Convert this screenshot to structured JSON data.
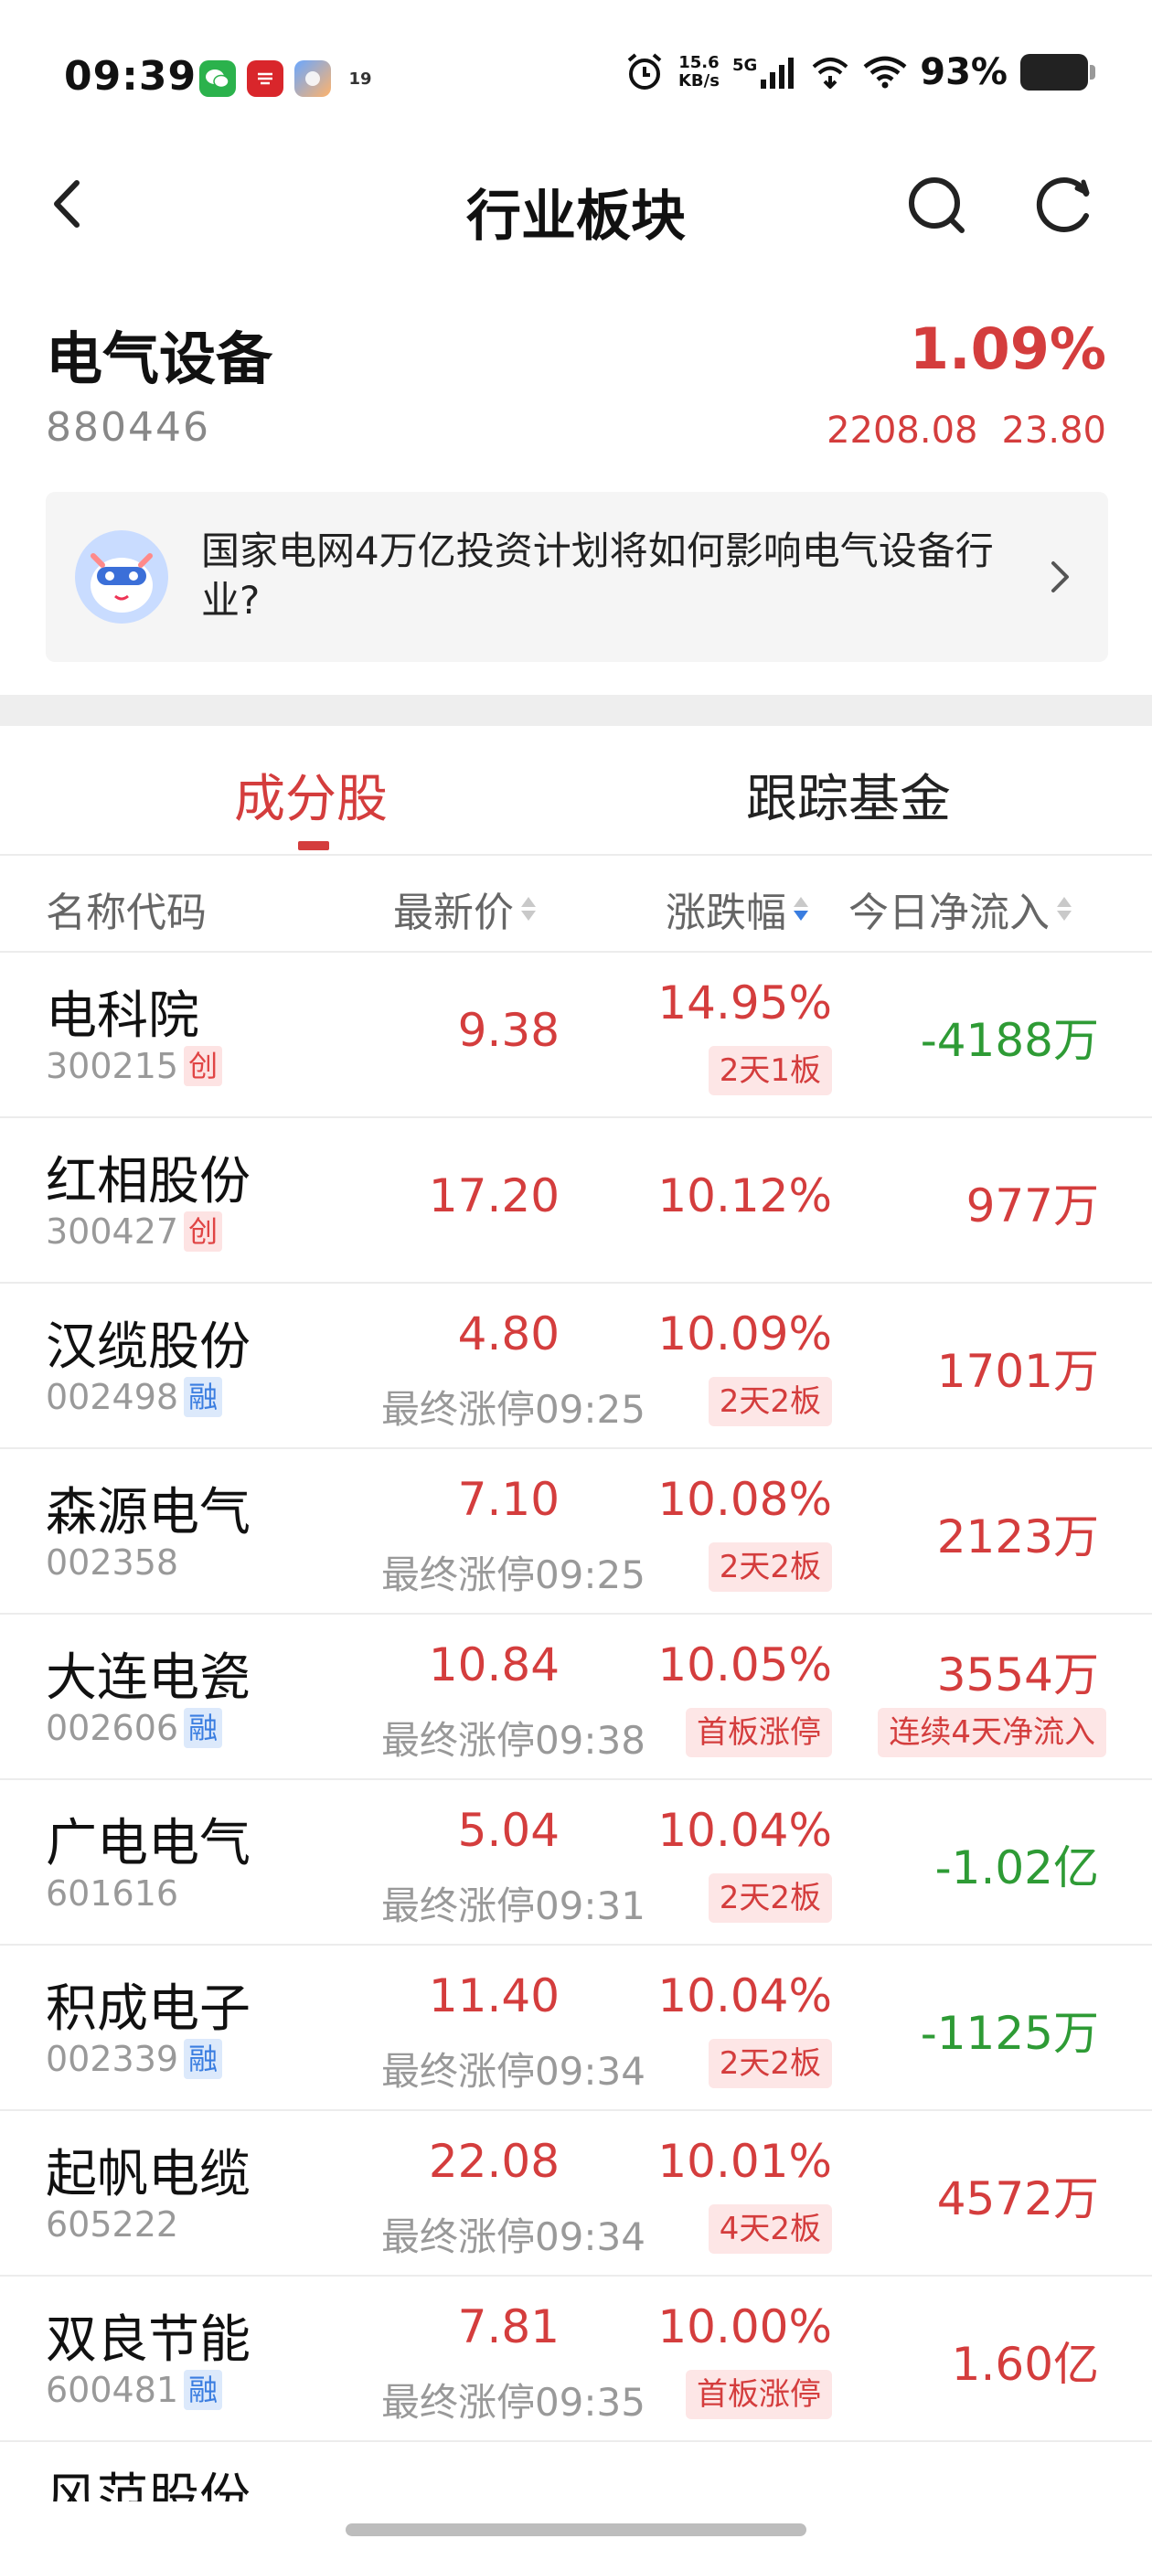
{
  "status_bar": {
    "time": "09:39",
    "net_speed_value": "15.6",
    "net_speed_unit": "KB/s",
    "network": "5G",
    "battery": "93%",
    "app_icon_badge": "19"
  },
  "header": {
    "title": "行业板块"
  },
  "sector": {
    "name": "电气设备",
    "code": "880446",
    "change_pct": "1.09%",
    "index_value": "2208.08",
    "change_value": "23.80"
  },
  "question_card": {
    "text": "国家电网4万亿投资计划将如何影响电气设备行业?"
  },
  "tabs": [
    {
      "label": "成分股",
      "active": true
    },
    {
      "label": "跟踪基金",
      "active": false
    }
  ],
  "table_header": {
    "name_code": "名称代码",
    "latest_price": "最新价",
    "change_pct": "涨跌幅",
    "net_inflow": "今日净流入"
  },
  "stocks": [
    {
      "name": "电科院",
      "code": "300215",
      "badge": "创",
      "price": "9.38",
      "limit_time": "",
      "pct": "14.95%",
      "tag": "2天1板",
      "flow": "-4188万",
      "flow_dir": "neg",
      "flow_tag": ""
    },
    {
      "name": "红相股份",
      "code": "300427",
      "badge": "创",
      "price": "17.20",
      "limit_time": "",
      "pct": "10.12%",
      "tag": "",
      "flow": "977万",
      "flow_dir": "pos",
      "flow_tag": ""
    },
    {
      "name": "汉缆股份",
      "code": "002498",
      "badge": "融",
      "price": "4.80",
      "limit_time": "最终涨停09:25",
      "pct": "10.09%",
      "tag": "2天2板",
      "flow": "1701万",
      "flow_dir": "pos",
      "flow_tag": ""
    },
    {
      "name": "森源电气",
      "code": "002358",
      "badge": "",
      "price": "7.10",
      "limit_time": "最终涨停09:25",
      "pct": "10.08%",
      "tag": "2天2板",
      "flow": "2123万",
      "flow_dir": "pos",
      "flow_tag": ""
    },
    {
      "name": "大连电瓷",
      "code": "002606",
      "badge": "融",
      "price": "10.84",
      "limit_time": "最终涨停09:38",
      "pct": "10.05%",
      "tag": "首板涨停",
      "flow": "3554万",
      "flow_dir": "pos",
      "flow_tag": "连续4天净流入"
    },
    {
      "name": "广电电气",
      "code": "601616",
      "badge": "",
      "price": "5.04",
      "limit_time": "最终涨停09:31",
      "pct": "10.04%",
      "tag": "2天2板",
      "flow": "-1.02亿",
      "flow_dir": "neg",
      "flow_tag": ""
    },
    {
      "name": "积成电子",
      "code": "002339",
      "badge": "融",
      "price": "11.40",
      "limit_time": "最终涨停09:34",
      "pct": "10.04%",
      "tag": "2天2板",
      "flow": "-1125万",
      "flow_dir": "neg",
      "flow_tag": ""
    },
    {
      "name": "起帆电缆",
      "code": "605222",
      "badge": "",
      "price": "22.08",
      "limit_time": "最终涨停09:34",
      "pct": "10.01%",
      "tag": "4天2板",
      "flow": "4572万",
      "flow_dir": "pos",
      "flow_tag": ""
    },
    {
      "name": "双良节能",
      "code": "600481",
      "badge": "融",
      "price": "7.81",
      "limit_time": "最终涨停09:35",
      "pct": "10.00%",
      "tag": "首板涨停",
      "flow": "1.60亿",
      "flow_dir": "pos",
      "flow_tag": ""
    }
  ],
  "partial_row": {
    "name": "风范股份"
  },
  "colors": {
    "up_red": "#d43d3d",
    "down_green": "#2e9b35",
    "rong_blue": "#3a7de0"
  }
}
